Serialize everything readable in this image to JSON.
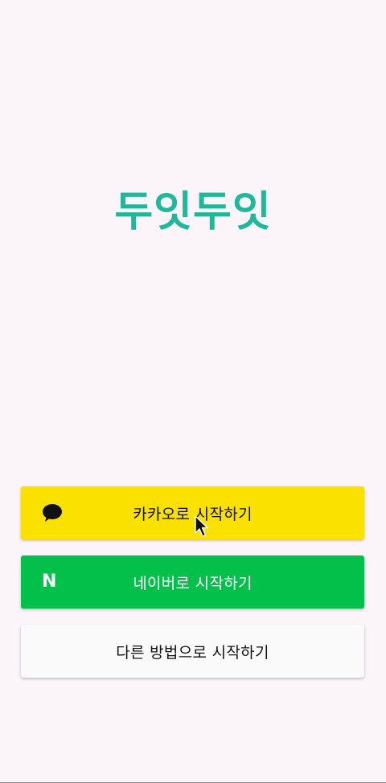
{
  "app": {
    "title": "두잇두잇"
  },
  "buttons": {
    "kakao_label": "카카오로 시작하기",
    "naver_label": "네이버로 시작하기",
    "other_label": "다른 방법으로 시작하기",
    "naver_icon_glyph": "N"
  },
  "colors": {
    "background": "#fbf5f9",
    "title": "#1fb89a",
    "kakao": "#fae100",
    "naver": "#03c04a",
    "other": "#fafafa"
  },
  "icons": {
    "kakao": "speech-bubble-icon",
    "naver": "naver-n-icon",
    "pointer": "mouse-cursor-icon"
  }
}
